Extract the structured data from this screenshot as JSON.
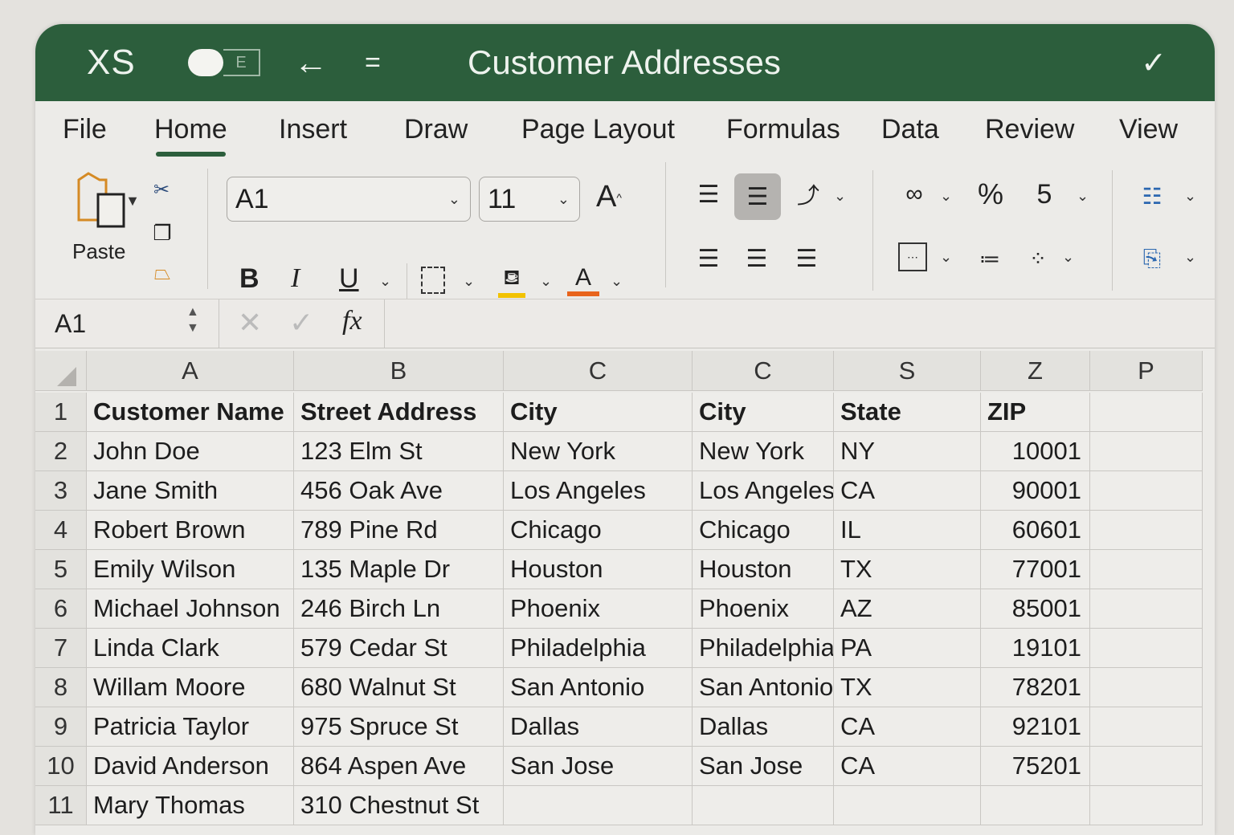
{
  "app": {
    "logo": "XS",
    "title": "Customer Addresses",
    "toggle_icon": "E"
  },
  "tabs": [
    {
      "label": "File"
    },
    {
      "label": "Home",
      "active": true
    },
    {
      "label": "Insert"
    },
    {
      "label": "Draw"
    },
    {
      "label": "Page Layout"
    },
    {
      "label": "Formulas"
    },
    {
      "label": "Data"
    },
    {
      "label": "Review"
    },
    {
      "label": "View"
    }
  ],
  "ribbon": {
    "paste_label": "Paste",
    "font_name": "A1",
    "font_size": "11",
    "bold": "B",
    "italic": "I",
    "underline": "U",
    "font_color_letter": "A",
    "grow_font": "A",
    "highlight_color": "#f2c200",
    "font_color": "#e8641c"
  },
  "formula_bar": {
    "name_box": "A1",
    "fx": "fx",
    "value": ""
  },
  "sheet": {
    "columns": [
      "A",
      "B",
      "C",
      "C",
      "S",
      "Z",
      "P"
    ],
    "rows": [
      [
        "Customer Name",
        "Street Address",
        "City",
        "City",
        "State",
        "ZIP",
        ""
      ],
      [
        "John Doe",
        "123 Elm St",
        "New York",
        "New York",
        "NY",
        "10001",
        ""
      ],
      [
        "Jane Smith",
        "456 Oak Ave",
        "Los Angeles",
        "Los Angeles",
        "CA",
        "90001",
        ""
      ],
      [
        "Robert Brown",
        "789 Pine Rd",
        "Chicago",
        "Chicago",
        "IL",
        "60601",
        ""
      ],
      [
        "Emily Wilson",
        "135 Maple Dr",
        "Houston",
        "Houston",
        "TX",
        "77001",
        ""
      ],
      [
        "Michael Johnson",
        "246 Birch Ln",
        "Phoenix",
        "Phoenix",
        "AZ",
        "85001",
        ""
      ],
      [
        "Linda Clark",
        "579 Cedar St",
        "Philadelphia",
        "Philadelphia",
        "PA",
        "19101",
        ""
      ],
      [
        "Willam Moore",
        "680 Walnut St",
        "San Antonio",
        "San Antonio",
        "TX",
        "78201",
        ""
      ],
      [
        "Patricia Taylor",
        "975 Spruce St",
        "Dallas",
        "Dallas",
        "CA",
        "92101",
        ""
      ],
      [
        "David Anderson",
        "864 Aspen Ave",
        "San Jose",
        "San Jose",
        "CA",
        "75201",
        ""
      ],
      [
        "Mary Thomas",
        "310 Chestnut St",
        "",
        "",
        "",
        "",
        ""
      ]
    ]
  }
}
